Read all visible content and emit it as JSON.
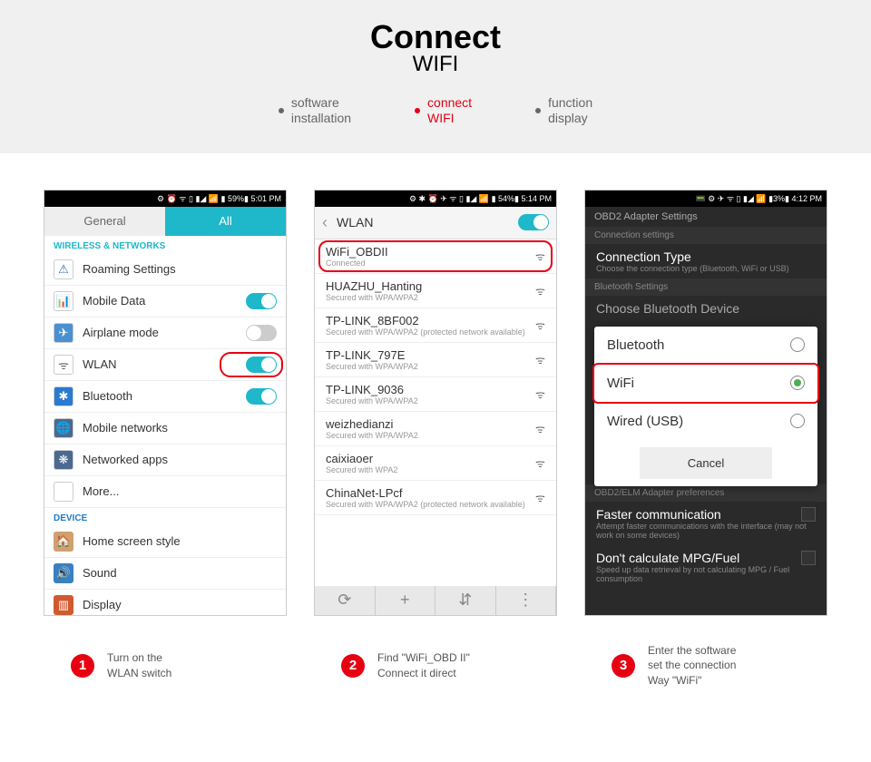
{
  "header": {
    "title": "Connect",
    "subtitle": "WIFI"
  },
  "tabs": [
    {
      "label": "software\ninstallation"
    },
    {
      "label": "connect\nWIFI"
    },
    {
      "label": "function\ndisplay"
    }
  ],
  "phone1": {
    "status": "⚙ ⏰ ᯤ ▯ ▮◢ 📶 ▮ 59%▮ 5:01 PM",
    "tab_general": "General",
    "tab_all": "All",
    "sect1": "WIRELESS & NETWORKS",
    "items": [
      {
        "icon": "⚠",
        "bg": "#fff",
        "fg": "#3a6ea5",
        "label": "Roaming Settings",
        "toggle": null
      },
      {
        "icon": "📊",
        "bg": "#fff",
        "fg": "#4a90d0",
        "label": "Mobile Data",
        "toggle": "on"
      },
      {
        "icon": "✈",
        "bg": "#4a90d0",
        "fg": "#fff",
        "label": "Airplane mode",
        "toggle": "off"
      },
      {
        "icon": "ᯤ",
        "bg": "#fff",
        "fg": "#666",
        "label": "WLAN",
        "toggle": "on",
        "hl": true
      },
      {
        "icon": "✱",
        "bg": "#2a7ad0",
        "fg": "#fff",
        "label": "Bluetooth",
        "toggle": "on"
      },
      {
        "icon": "🌐",
        "bg": "#4a6a90",
        "fg": "#fff",
        "label": "Mobile networks",
        "toggle": null
      },
      {
        "icon": "❋",
        "bg": "#4a6a90",
        "fg": "#fff",
        "label": "Networked apps",
        "toggle": null
      },
      {
        "icon": "",
        "bg": "transparent",
        "fg": "",
        "label": "More...",
        "toggle": null
      }
    ],
    "sect2": "DEVICE",
    "items2": [
      {
        "icon": "🏠",
        "bg": "#d0a070",
        "label": "Home screen style"
      },
      {
        "icon": "🔊",
        "bg": "#3a80c0",
        "label": "Sound"
      },
      {
        "icon": "▥",
        "bg": "#d05a30",
        "label": "Display"
      }
    ]
  },
  "phone2": {
    "status": "⚙ ✱ ⏰ ✈ ᯤ ▯ ▮◢ 📶 ▮ 54%▮ 5:14 PM",
    "hdr": "WLAN",
    "nets": [
      {
        "name": "WiFi_OBDII",
        "sub": "Connected",
        "hl": true
      },
      {
        "name": "HUAZHU_Hanting",
        "sub": "Secured with WPA/WPA2"
      },
      {
        "name": "TP-LINK_8BF002",
        "sub": "Secured with WPA/WPA2 (protected network available)"
      },
      {
        "name": "TP-LINK_797E",
        "sub": "Secured with WPA/WPA2"
      },
      {
        "name": "TP-LINK_9036",
        "sub": "Secured with WPA/WPA2"
      },
      {
        "name": "weizhedianzi",
        "sub": "Secured with WPA/WPA2"
      },
      {
        "name": "caixiaoer",
        "sub": "Secured with WPA2"
      },
      {
        "name": "ChinaNet-LPcf",
        "sub": "Secured with WPA/WPA2 (protected network available)"
      }
    ]
  },
  "phone3": {
    "status": "📟 ⚙ ✈ ᯤ ▯ ▮◢ 📶 ▮3%▮ 4:12 PM",
    "hdr": "OBD2 Adapter Settings",
    "sect_conn": "Connection settings",
    "conn_title": "Connection Type",
    "conn_sub": "Choose the connection type (Bluetooth, WiFi or USB)",
    "sect_bt": "Bluetooth Settings",
    "bt_choose": "Choose Bluetooth Device",
    "modal": {
      "opt1": "Bluetooth",
      "opt2": "WiFi",
      "opt3": "Wired (USB)",
      "cancel": "Cancel"
    },
    "elm_pref": "OBD2/ELM Adapter preferences",
    "fast": "Faster communication",
    "fast_sub": "Attempt faster communications with the interface (may not work on some devices)",
    "mpg": "Don't calculate MPG/Fuel",
    "mpg_sub": "Speed up data retrieval by not calculating MPG / Fuel consumption"
  },
  "captions": [
    {
      "num": "1",
      "text": "Turn on the\nWLAN switch"
    },
    {
      "num": "2",
      "text": "Find \"WiFi_OBD II\"\nConnect it direct"
    },
    {
      "num": "3",
      "text": "Enter the software\nset the connection\nWay \"WiFi\""
    }
  ]
}
